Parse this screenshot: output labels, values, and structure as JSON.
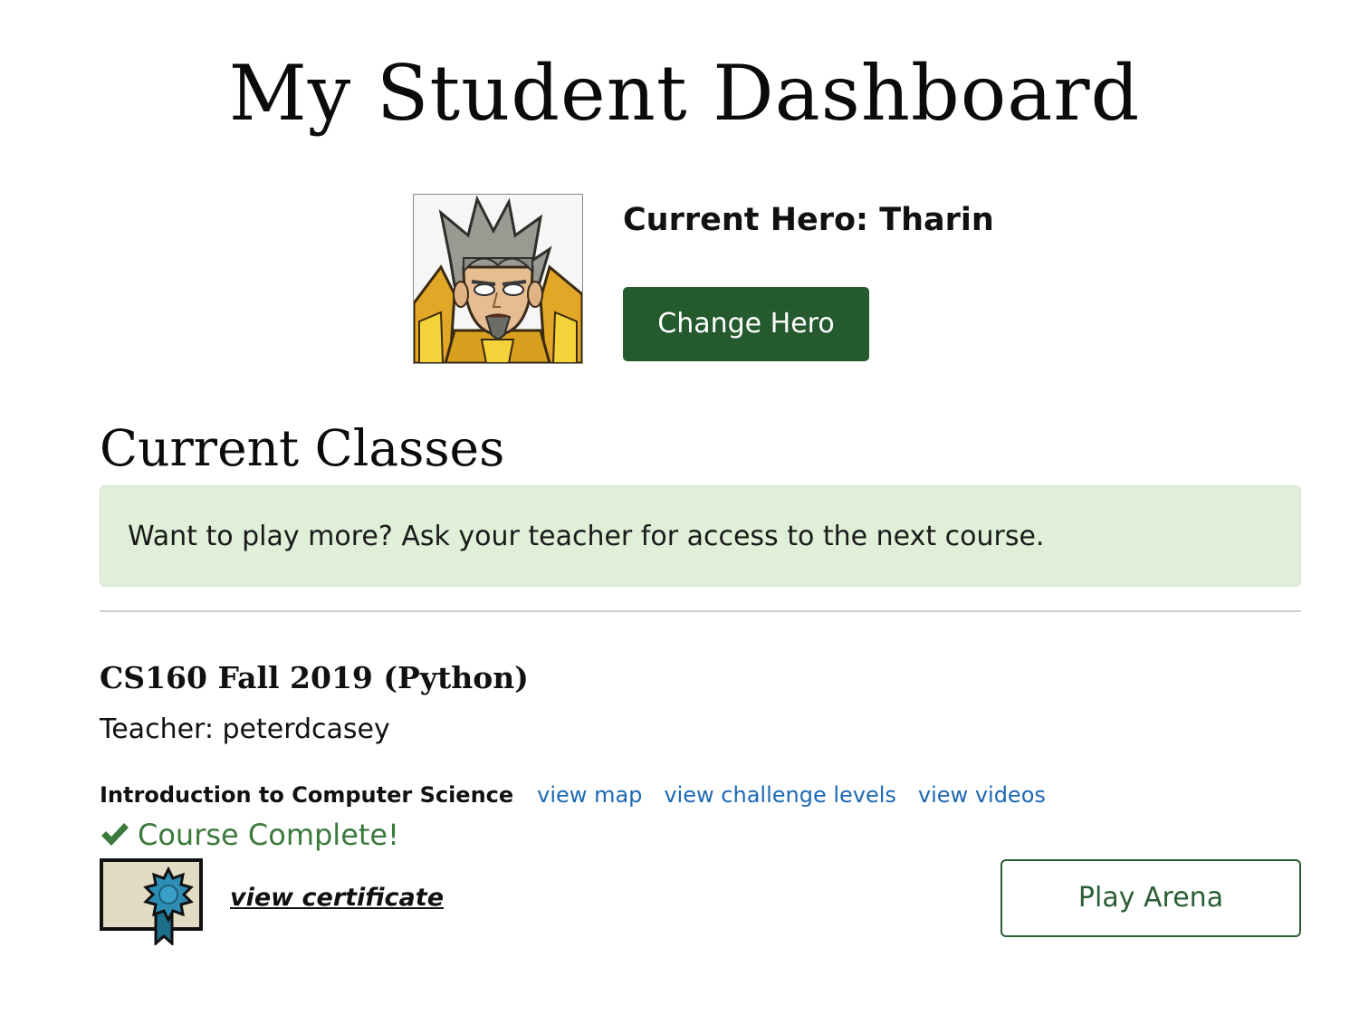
{
  "page": {
    "title": "My Student Dashboard"
  },
  "hero": {
    "label": "Current Hero: Tharin",
    "change_button": "Change Hero",
    "avatar_icon": "hero-tharin-portrait"
  },
  "classes": {
    "section_title": "Current Classes",
    "notice": "Want to play more? Ask your teacher for access to the next course.",
    "items": [
      {
        "name": "CS160 Fall 2019 (Python)",
        "teacher": "Teacher: peterdcasey",
        "course": {
          "name": "Introduction to Computer Science",
          "links": [
            "view map",
            "view challenge levels",
            "view videos"
          ],
          "status": "Course Complete!",
          "status_icon": "checkmark-icon",
          "certificate_link": "view certificate",
          "certificate_icon": "certificate-icon",
          "play_button": "Play Arena"
        }
      }
    ]
  },
  "colors": {
    "primary_green": "#255a2e",
    "notice_bg": "#dfefd8",
    "link_blue": "#1c69b3",
    "success_green": "#3b7a3b"
  }
}
